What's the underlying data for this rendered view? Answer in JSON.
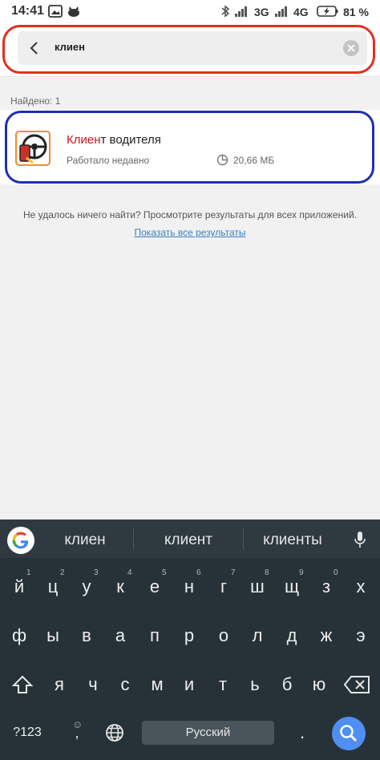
{
  "status_bar": {
    "time": "14:41",
    "network_1": "3G",
    "network_2": "4G",
    "battery": "81 %",
    "icons": [
      "gallery-icon",
      "cat-icon",
      "bluetooth-icon",
      "signal-icon",
      "signal-icon",
      "battery-charging-icon"
    ]
  },
  "search": {
    "query": "клиен",
    "back_icon": "back-arrow-icon",
    "clear_icon": "clear-icon",
    "outline_color": "#e0301e"
  },
  "results": {
    "found_label": "Найдено: 1",
    "items": [
      {
        "name_highlight": "Клиен",
        "name_rest": "т водителя",
        "status": "Работало недавно",
        "size": "20,66 МБ",
        "icon": "steering-wheel-icon"
      }
    ],
    "outline_color": "#1f2fb0",
    "no_results_text": "Не удалось ничего найти? Просмотрите результаты для всех приложений.",
    "show_all_link": "Показать все результаты"
  },
  "keyboard": {
    "suggestions": [
      "клиен",
      "клиент",
      "клиенты"
    ],
    "row1": [
      {
        "key": "й",
        "hint": "1"
      },
      {
        "key": "ц",
        "hint": "2"
      },
      {
        "key": "у",
        "hint": "3"
      },
      {
        "key": "к",
        "hint": "4"
      },
      {
        "key": "е",
        "hint": "5"
      },
      {
        "key": "н",
        "hint": "6"
      },
      {
        "key": "г",
        "hint": "7"
      },
      {
        "key": "ш",
        "hint": "8"
      },
      {
        "key": "щ",
        "hint": "9"
      },
      {
        "key": "з",
        "hint": "0"
      },
      {
        "key": "х",
        "hint": ""
      }
    ],
    "row2": [
      "ф",
      "ы",
      "в",
      "а",
      "п",
      "р",
      "о",
      "л",
      "д",
      "ж",
      "э"
    ],
    "row3": [
      "я",
      "ч",
      "с",
      "м",
      "и",
      "т",
      "ь",
      "б",
      "ю"
    ],
    "symbols_key": "?123",
    "emoji_key": "☺",
    "comma_key": ",",
    "space_label": "Русский",
    "period_key": ".",
    "accent_color": "#4f8ef2"
  }
}
